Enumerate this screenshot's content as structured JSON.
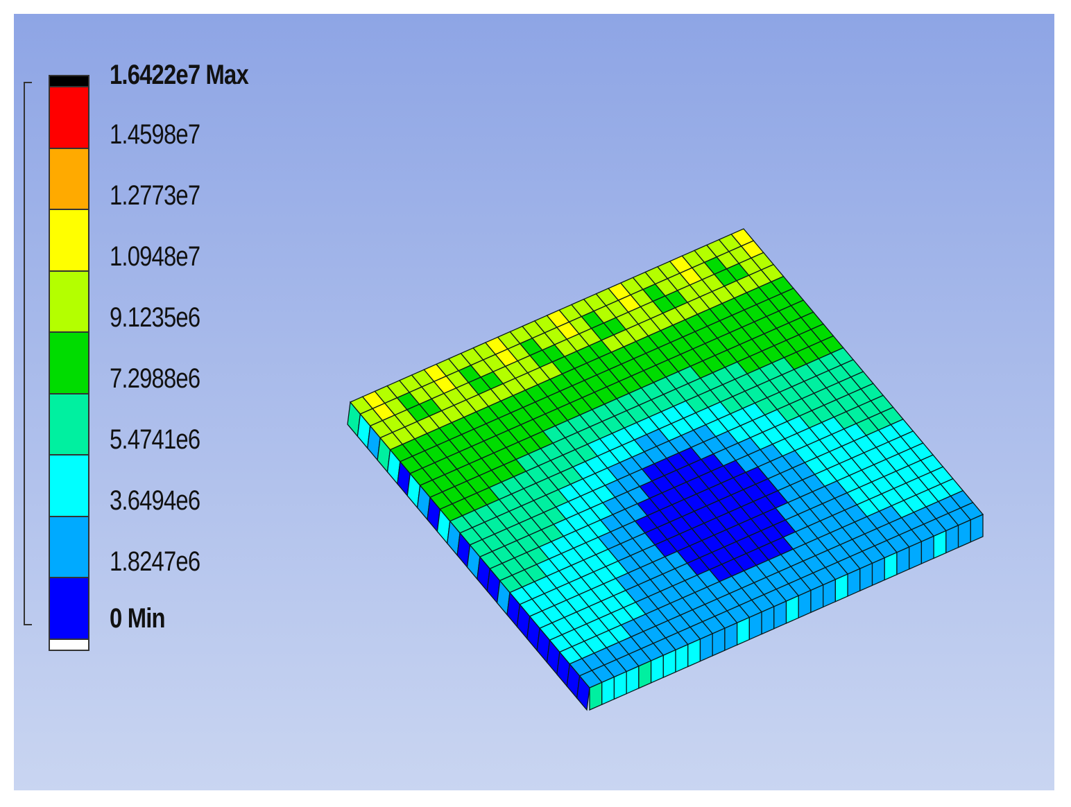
{
  "legend": {
    "max_label": "1.6422e7 Max",
    "min_label": "0 Min",
    "labels": [
      "1.4598e7",
      "1.2773e7",
      "1.0948e7",
      "9.1235e6",
      "7.2988e6",
      "5.4741e6",
      "3.6494e6",
      "1.8247e6"
    ],
    "colors": [
      "#000000",
      "#ff0000",
      "#ffaa00",
      "#ffff00",
      "#b4ff00",
      "#00dc00",
      "#00f0a0",
      "#00ffff",
      "#00aaff",
      "#0000ff",
      "#ffffff"
    ]
  }
}
